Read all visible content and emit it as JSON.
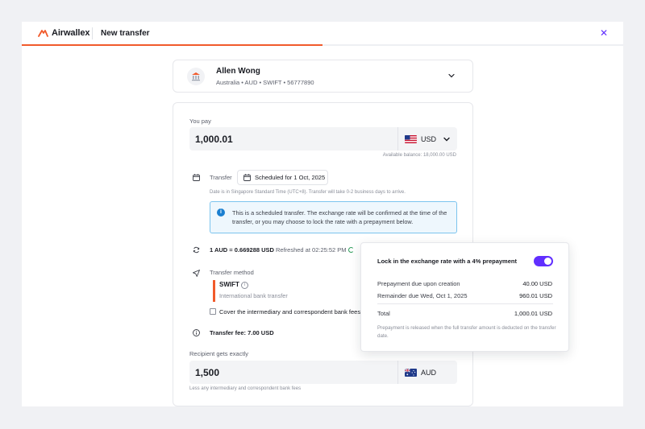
{
  "header": {
    "brand": "Airwallex",
    "title": "New transfer",
    "close_icon": "close-icon",
    "progress_fraction": 0.5
  },
  "recipient": {
    "name": "Allen Wong",
    "meta": "Australia  •  AUD  •  SWIFT  •  56777890",
    "icon": "bank-icon"
  },
  "pay": {
    "label": "You pay",
    "amount": "1,000.01",
    "currency": "USD",
    "available": "Available balance: 18,000.00 USD"
  },
  "transfer": {
    "label": "Transfer",
    "scheduled": "Scheduled for 1 Oct, 2025",
    "date_note": "Date is in Singapore Standard Time (UTC+8). Transfer will take 0-2 business days to arrive."
  },
  "info": {
    "text": "This is a scheduled transfer. The exchange rate will be confirmed at the time of the transfer, or you may choose to lock the rate with a prepayment below."
  },
  "rate": {
    "text": "1 AUD = 0.669288 USD",
    "refreshed": "Refreshed at 02:25:52 PM"
  },
  "method": {
    "label": "Transfer method",
    "name": "SWIFT",
    "sub": "International bank transfer",
    "cover_label": "Cover the intermediary and correspondent bank fees",
    "cover_checked": false
  },
  "fee": {
    "text": "Transfer fee: 7.00 USD"
  },
  "receive": {
    "label": "Recipient gets exactly",
    "amount": "1,500",
    "currency": "AUD",
    "note": "Less any intermediary and correspondent bank fees"
  },
  "popover": {
    "title": "Lock in the exchange rate with a 4% prepayment",
    "toggle_on": true,
    "rows": [
      {
        "label": "Prepayment due upon creation",
        "value": "40.00 USD"
      },
      {
        "label": "Remainder due Wed, Oct 1, 2025",
        "value": "960.01 USD"
      }
    ],
    "total_label": "Total",
    "total_value": "1,000.01 USD",
    "note": "Prepayment is released when the full transfer amount is deducted on the transfer date."
  },
  "colors": {
    "accent": "#612fff",
    "brand": "#f15a2b",
    "info_border": "#7cc4ee"
  }
}
